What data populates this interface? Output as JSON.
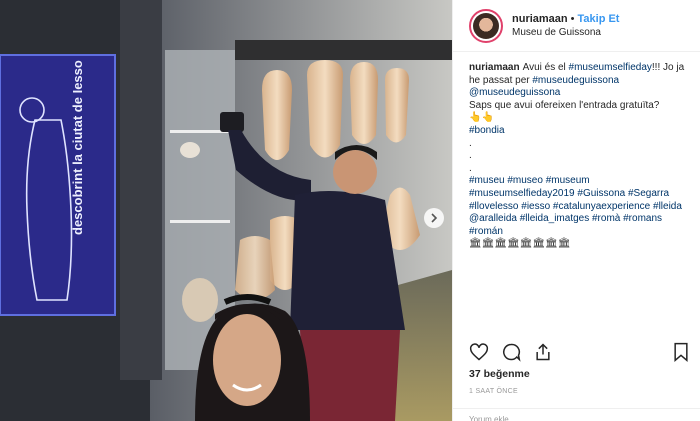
{
  "header": {
    "username": "nuriamaan",
    "separator": "•",
    "follow_label": "Takip Et",
    "location": "Museu de Guissona"
  },
  "photo": {
    "banner_text": "descobrint la ciutat de Iesso",
    "next_icon": "chevron-right-icon"
  },
  "caption": {
    "username": "nuriamaan",
    "line1_text": "Avui és el ",
    "line1_tag": "#museumselfieday",
    "line1_after": "!!! Jo ja he passat per ",
    "line1_tag2": "#museudeguissona",
    "line1_tag3": "@museudeguissona",
    "line2": "Saps que avui ofereixen l'entrada gratuïta?",
    "emoji_row1": "👆👆",
    "tag_bondia": "#bondia",
    "dots": [
      ".",
      ".",
      "."
    ],
    "tags_block": "#museu #museo #museum #museumselfieday2019 #Guissona #Segarra #llovelesso #iesso #catalunyaexperience #lleida @aralleida #lleida_imatges #romà #romans #román",
    "emoji_row2": "🏛🏛🏛🏛🏛🏛🏛🏛"
  },
  "actions": {
    "like_icon": "heart-icon",
    "comment_icon": "comment-icon",
    "share_icon": "share-icon",
    "save_icon": "bookmark-icon"
  },
  "likes": "37 beğenme",
  "time": "1 SAAT ÖNCE",
  "comment_placeholder": "Yorum ekle..."
}
